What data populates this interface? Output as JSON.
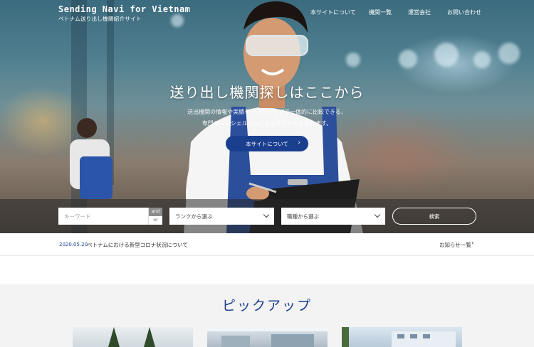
{
  "header": {
    "logo_name": "Sending Navi for Vietnam",
    "logo_sub": "ベトナム送り出し機関紹介サイト",
    "nav": [
      "本サイトについて",
      "機関一覧",
      "運営会社",
      "お問い合わせ"
    ]
  },
  "hero": {
    "headline": "送り出し機関探しはここから",
    "lead_line1": "送出機関の情報や実績をワンストップで一体的に比較できる、",
    "lead_line2": "専門のコンシェルジュによるサポートも致します。",
    "about_button": "本サイトについて"
  },
  "search": {
    "keyword_placeholder": "キーワード",
    "and_label": "and",
    "or_label": "or",
    "rank_select": "ランクから選ぶ",
    "job_select": "職種から選ぶ",
    "search_button": "検索"
  },
  "news": {
    "date": "2020.05.20",
    "title": "ベトナムにおける新型コロナ状況について",
    "more_link": "お知らせ一覧"
  },
  "pickup": {
    "heading": "ピックアップ"
  },
  "colors": {
    "brand": "#1b3f8f",
    "pickup_bg": "#f3f3f3"
  }
}
